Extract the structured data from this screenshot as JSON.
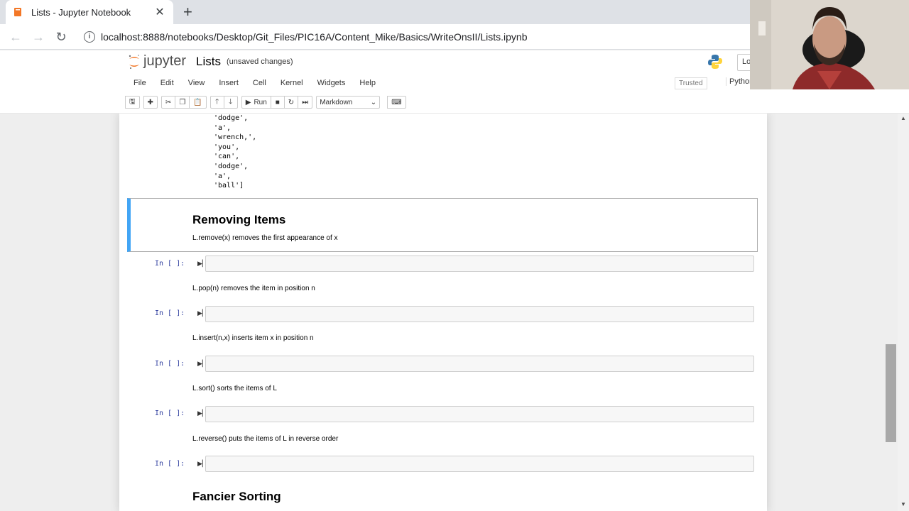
{
  "browser": {
    "tab_title": "Lists - Jupyter Notebook",
    "url": "localhost:8888/notebooks/Desktop/Git_Files/PIC16A/Content_Mike/Basics/WriteOnsII/Lists.ipynb"
  },
  "jupyter": {
    "logo_text": "jupyter",
    "notebook_name": "Lists",
    "save_status": "(unsaved changes)",
    "logout_label": "Lo",
    "menu": [
      "File",
      "Edit",
      "View",
      "Insert",
      "Cell",
      "Kernel",
      "Widgets",
      "Help"
    ],
    "trusted": "Trusted",
    "kernel": "Python",
    "run_label": "Run",
    "cell_type": "Markdown"
  },
  "notebook": {
    "output_lines": [
      "'dodge',",
      "'a',",
      "'wrench,',",
      "'you',",
      "'can',",
      "'dodge',",
      "'a',",
      "'ball']"
    ],
    "removing_heading": "Removing Items",
    "prompt": "In [ ]:",
    "texts": {
      "remove": "L.remove(x) removes the first appearance of x",
      "pop": "L.pop(n) removes the item in position n",
      "insert": "L.insert(n,x) inserts item x in position n",
      "sort": "L.sort() sorts the items of L",
      "reverse": "L.reverse() puts the items of L in reverse order"
    },
    "fancier_heading": "Fancier Sorting"
  },
  "colors": {
    "selected_cell_bar": "#42a5f5",
    "prompt": "#303f9f",
    "jupyter_orange": "#f37726"
  }
}
